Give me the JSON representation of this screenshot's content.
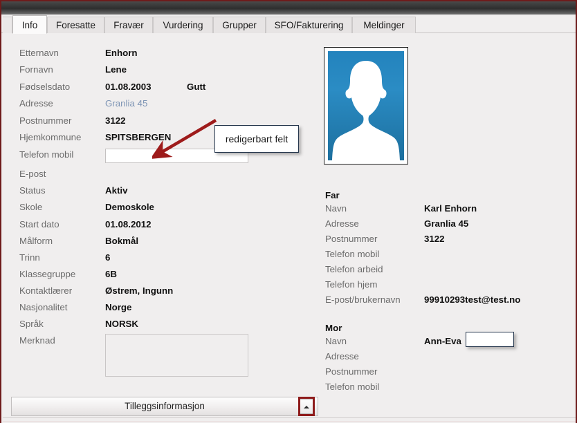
{
  "window": {
    "titlebar_color": "#3a3a3a",
    "accent_border_color": "#6e1b1b"
  },
  "tabs": [
    {
      "label": "Info",
      "active": true
    },
    {
      "label": "Foresatte",
      "active": false
    },
    {
      "label": "Fravær",
      "active": false
    },
    {
      "label": "Vurdering",
      "active": false
    },
    {
      "label": "Grupper",
      "active": false
    },
    {
      "label": "SFO/Fakturering",
      "active": false
    },
    {
      "label": "Meldinger",
      "active": false
    }
  ],
  "student": {
    "fields": [
      {
        "label": "Etternavn",
        "value": "Enhorn",
        "type": "text"
      },
      {
        "label": "Fornavn",
        "value": "Lene",
        "type": "text"
      },
      {
        "label": "Fødselsdato",
        "value": "01.08.2003",
        "type": "text",
        "extra": "Gutt"
      },
      {
        "label": "Adresse",
        "value": "Granlia 45",
        "type": "link"
      },
      {
        "label": "Postnummer",
        "value": "3122",
        "type": "text"
      },
      {
        "label": "Hjemkommune",
        "value": "SPITSBERGEN",
        "type": "text"
      },
      {
        "label": "Telefon mobil",
        "value": "",
        "type": "input"
      },
      {
        "label": "E-post",
        "value": "",
        "type": "text"
      },
      {
        "label": "Status",
        "value": "Aktiv",
        "type": "text"
      },
      {
        "label": "Skole",
        "value": "Demoskole",
        "type": "text"
      },
      {
        "label": "Start dato",
        "value": "01.08.2012",
        "type": "text"
      },
      {
        "label": "Målform",
        "value": "Bokmål",
        "type": "text"
      },
      {
        "label": "Trinn",
        "value": "6",
        "type": "text"
      },
      {
        "label": "Klassegruppe",
        "value": "6B",
        "type": "text"
      },
      {
        "label": "Kontaktlærer",
        "value": "Østrem, Ingunn",
        "type": "text"
      },
      {
        "label": "Nasjonalitet",
        "value": "Norge",
        "type": "text"
      },
      {
        "label": "Språk",
        "value": "NORSK",
        "type": "text"
      },
      {
        "label": "Merknad",
        "value": "",
        "type": "textarea"
      }
    ]
  },
  "photo": {
    "icon": "person-silhouette-icon",
    "background_color": "#2b8cc4"
  },
  "guardians": [
    {
      "heading": "Far",
      "fields": [
        {
          "label": "Navn",
          "value": "Karl Enhorn"
        },
        {
          "label": "Adresse",
          "value": "Granlia 45"
        },
        {
          "label": "Postnummer",
          "value": "3122"
        },
        {
          "label": "Telefon mobil",
          "value": ""
        },
        {
          "label": "Telefon arbeid",
          "value": ""
        },
        {
          "label": "Telefon hjem",
          "value": ""
        },
        {
          "label": "E-post/brukernavn",
          "value": "99910293test@test.no"
        }
      ]
    },
    {
      "heading": "Mor",
      "fields": [
        {
          "label": "Navn",
          "value": "Ann-Eva",
          "redacted": true
        },
        {
          "label": "Adresse",
          "value": ""
        },
        {
          "label": "Postnummer",
          "value": ""
        },
        {
          "label": "Telefon mobil",
          "value": ""
        }
      ]
    }
  ],
  "annotation": {
    "callout_text": "redigerbart felt",
    "arrow_color": "#9e1b1b",
    "callout_border_color": "#26374d",
    "highlight_color": "#8e1b1b"
  },
  "footer": {
    "expander_label": "Tilleggsinformasjon",
    "expander_icon": "chevron-up-icon"
  }
}
